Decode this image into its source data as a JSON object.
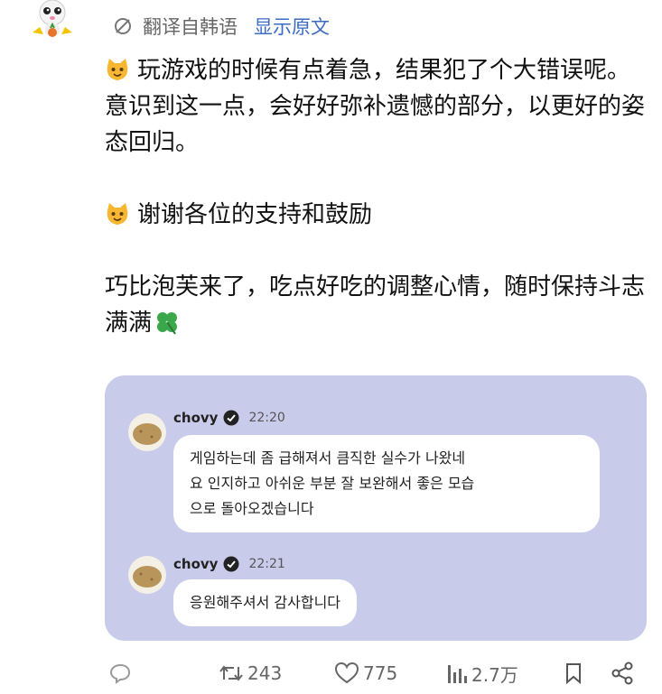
{
  "translation": {
    "label": "翻译自韩语",
    "show_original": "显示原文"
  },
  "post": {
    "line1": "玩游戏的时候有点着急，结果犯了个大错误呢。意识到这一点，会好好弥补遗憾的部分，以更好的姿态回归。",
    "line2": "谢谢各位的支持和鼓励",
    "line3": "巧比泡芙来了，吃点好吃的调整心情，随时保持斗志满满",
    "emoji_icons": [
      "cat-face-icon",
      "clover-icon"
    ]
  },
  "card": {
    "background": "#c9cbea",
    "messages": [
      {
        "name": "chovy",
        "time": "22:20",
        "text_lines": [
          "게임하는데 좀 급해져서 큼직한 실수가 나왔네",
          "요 인지하고 아쉬운 부분 잘 보완해서 좋은 모습",
          "으로 돌아오겠습니다"
        ]
      },
      {
        "name": "chovy",
        "time": "22:21",
        "text_lines": [
          "응원해주셔서 감사합니다"
        ]
      }
    ]
  },
  "actions": {
    "retweets": "243",
    "likes": "775",
    "views": "2.7万"
  }
}
